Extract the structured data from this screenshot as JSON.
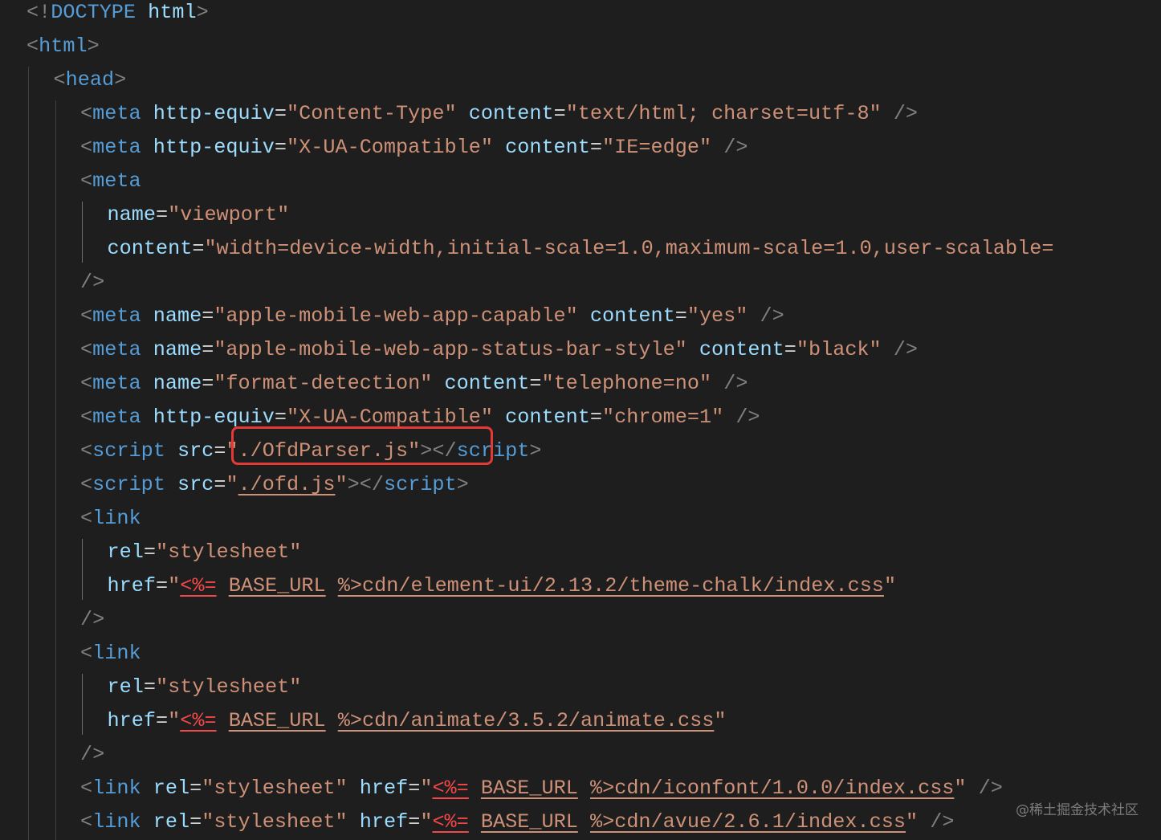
{
  "editor": {
    "lines": [
      {
        "indent": 0,
        "tokens": [
          [
            "punct",
            "<!"
          ],
          [
            "tag",
            "DOCTYPE"
          ],
          [
            "plain",
            " "
          ],
          [
            "attr",
            "html"
          ],
          [
            "punct",
            ">"
          ]
        ]
      },
      {
        "indent": 0,
        "tokens": [
          [
            "punct",
            "<"
          ],
          [
            "tag",
            "html"
          ],
          [
            "punct",
            ">"
          ]
        ]
      },
      {
        "indent": 1,
        "tokens": [
          [
            "punct",
            "<"
          ],
          [
            "tag",
            "head"
          ],
          [
            "punct",
            ">"
          ]
        ]
      },
      {
        "indent": 2,
        "tokens": [
          [
            "punct",
            "<"
          ],
          [
            "tag",
            "meta"
          ],
          [
            "plain",
            " "
          ],
          [
            "attr",
            "http-equiv"
          ],
          [
            "eq",
            "="
          ],
          [
            "str",
            "\"Content-Type\""
          ],
          [
            "plain",
            " "
          ],
          [
            "attr",
            "content"
          ],
          [
            "eq",
            "="
          ],
          [
            "str",
            "\"text/html; charset=utf-8\""
          ],
          [
            "plain",
            " "
          ],
          [
            "punct",
            "/>"
          ]
        ]
      },
      {
        "indent": 2,
        "tokens": [
          [
            "punct",
            "<"
          ],
          [
            "tag",
            "meta"
          ],
          [
            "plain",
            " "
          ],
          [
            "attr",
            "http-equiv"
          ],
          [
            "eq",
            "="
          ],
          [
            "str",
            "\"X-UA-Compatible\""
          ],
          [
            "plain",
            " "
          ],
          [
            "attr",
            "content"
          ],
          [
            "eq",
            "="
          ],
          [
            "str",
            "\"IE=edge\""
          ],
          [
            "plain",
            " "
          ],
          [
            "punct",
            "/>"
          ]
        ]
      },
      {
        "indent": 2,
        "tokens": [
          [
            "punct",
            "<"
          ],
          [
            "tag",
            "meta"
          ]
        ]
      },
      {
        "indent": 3,
        "tokens": [
          [
            "attr",
            "name"
          ],
          [
            "eq",
            "="
          ],
          [
            "str",
            "\"viewport\""
          ]
        ]
      },
      {
        "indent": 3,
        "tokens": [
          [
            "attr",
            "content"
          ],
          [
            "eq",
            "="
          ],
          [
            "str",
            "\"width=device-width,initial-scale=1.0,maximum-scale=1.0,user-scalable="
          ]
        ]
      },
      {
        "indent": 2,
        "tokens": [
          [
            "punct",
            "/>"
          ]
        ]
      },
      {
        "indent": 2,
        "tokens": [
          [
            "punct",
            "<"
          ],
          [
            "tag",
            "meta"
          ],
          [
            "plain",
            " "
          ],
          [
            "attr",
            "name"
          ],
          [
            "eq",
            "="
          ],
          [
            "str",
            "\"apple-mobile-web-app-capable\""
          ],
          [
            "plain",
            " "
          ],
          [
            "attr",
            "content"
          ],
          [
            "eq",
            "="
          ],
          [
            "str",
            "\"yes\""
          ],
          [
            "plain",
            " "
          ],
          [
            "punct",
            "/>"
          ]
        ]
      },
      {
        "indent": 2,
        "tokens": [
          [
            "punct",
            "<"
          ],
          [
            "tag",
            "meta"
          ],
          [
            "plain",
            " "
          ],
          [
            "attr",
            "name"
          ],
          [
            "eq",
            "="
          ],
          [
            "str",
            "\"apple-mobile-web-app-status-bar-style\""
          ],
          [
            "plain",
            " "
          ],
          [
            "attr",
            "content"
          ],
          [
            "eq",
            "="
          ],
          [
            "str",
            "\"black\""
          ],
          [
            "plain",
            " "
          ],
          [
            "punct",
            "/>"
          ]
        ]
      },
      {
        "indent": 2,
        "tokens": [
          [
            "punct",
            "<"
          ],
          [
            "tag",
            "meta"
          ],
          [
            "plain",
            " "
          ],
          [
            "attr",
            "name"
          ],
          [
            "eq",
            "="
          ],
          [
            "str",
            "\"format-detection\""
          ],
          [
            "plain",
            " "
          ],
          [
            "attr",
            "content"
          ],
          [
            "eq",
            "="
          ],
          [
            "str",
            "\"telephone=no\""
          ],
          [
            "plain",
            " "
          ],
          [
            "punct",
            "/>"
          ]
        ]
      },
      {
        "indent": 2,
        "tokens": [
          [
            "punct",
            "<"
          ],
          [
            "tag",
            "meta"
          ],
          [
            "plain",
            " "
          ],
          [
            "attr",
            "http-equiv"
          ],
          [
            "eq",
            "="
          ],
          [
            "str",
            "\"X-UA-Compatible\""
          ],
          [
            "plain",
            " "
          ],
          [
            "attr",
            "content"
          ],
          [
            "eq",
            "="
          ],
          [
            "str",
            "\"chrome=1\""
          ],
          [
            "plain",
            " "
          ],
          [
            "punct",
            "/>"
          ]
        ]
      },
      {
        "indent": 2,
        "tokens": [
          [
            "punct",
            "<"
          ],
          [
            "tag",
            "script"
          ],
          [
            "plain",
            " "
          ],
          [
            "attr",
            "src"
          ],
          [
            "eq",
            "="
          ],
          [
            "str",
            "\"./OfdParser.js\""
          ],
          [
            "punct",
            "></"
          ],
          [
            "tag",
            "script"
          ],
          [
            "punct",
            ">"
          ]
        ]
      },
      {
        "indent": 2,
        "tokens": [
          [
            "punct",
            "<"
          ],
          [
            "tag",
            "script"
          ],
          [
            "plain",
            " "
          ],
          [
            "attr",
            "src"
          ],
          [
            "eq",
            "="
          ],
          [
            "str",
            "\""
          ],
          [
            "link",
            "./ofd.js"
          ],
          [
            "str",
            "\""
          ],
          [
            "punct",
            "></"
          ],
          [
            "tag",
            "script"
          ],
          [
            "punct",
            ">"
          ]
        ]
      },
      {
        "indent": 2,
        "tokens": [
          [
            "punct",
            "<"
          ],
          [
            "tag",
            "link"
          ]
        ]
      },
      {
        "indent": 3,
        "tokens": [
          [
            "attr",
            "rel"
          ],
          [
            "eq",
            "="
          ],
          [
            "str",
            "\"stylesheet\""
          ]
        ]
      },
      {
        "indent": 3,
        "tokens": [
          [
            "attr",
            "href"
          ],
          [
            "eq",
            "="
          ],
          [
            "str",
            "\""
          ],
          [
            "tmpl",
            "<%="
          ],
          [
            "plain",
            " "
          ],
          [
            "link",
            "BASE_URL"
          ],
          [
            "plain",
            " "
          ],
          [
            "link",
            "%>cdn/element-ui/2.13.2/theme-chalk/index.css"
          ],
          [
            "str",
            "\""
          ]
        ]
      },
      {
        "indent": 2,
        "tokens": [
          [
            "punct",
            "/>"
          ]
        ]
      },
      {
        "indent": 2,
        "tokens": [
          [
            "punct",
            "<"
          ],
          [
            "tag",
            "link"
          ]
        ]
      },
      {
        "indent": 3,
        "tokens": [
          [
            "attr",
            "rel"
          ],
          [
            "eq",
            "="
          ],
          [
            "str",
            "\"stylesheet\""
          ]
        ]
      },
      {
        "indent": 3,
        "tokens": [
          [
            "attr",
            "href"
          ],
          [
            "eq",
            "="
          ],
          [
            "str",
            "\""
          ],
          [
            "tmpl",
            "<%="
          ],
          [
            "plain",
            " "
          ],
          [
            "link",
            "BASE_URL"
          ],
          [
            "plain",
            " "
          ],
          [
            "link",
            "%>cdn/animate/3.5.2/animate.css"
          ],
          [
            "str",
            "\""
          ]
        ]
      },
      {
        "indent": 2,
        "tokens": [
          [
            "punct",
            "/>"
          ]
        ]
      },
      {
        "indent": 2,
        "tokens": [
          [
            "punct",
            "<"
          ],
          [
            "tag",
            "link"
          ],
          [
            "plain",
            " "
          ],
          [
            "attr",
            "rel"
          ],
          [
            "eq",
            "="
          ],
          [
            "str",
            "\"stylesheet\""
          ],
          [
            "plain",
            " "
          ],
          [
            "attr",
            "href"
          ],
          [
            "eq",
            "="
          ],
          [
            "str",
            "\""
          ],
          [
            "tmpl",
            "<%="
          ],
          [
            "plain",
            " "
          ],
          [
            "link",
            "BASE_URL"
          ],
          [
            "plain",
            " "
          ],
          [
            "link",
            "%>cdn/iconfont/1.0.0/index.css"
          ],
          [
            "str",
            "\""
          ],
          [
            "plain",
            " "
          ],
          [
            "punct",
            "/>"
          ]
        ]
      },
      {
        "indent": 2,
        "tokens": [
          [
            "punct",
            "<"
          ],
          [
            "tag",
            "link"
          ],
          [
            "plain",
            " "
          ],
          [
            "attr",
            "rel"
          ],
          [
            "eq",
            "="
          ],
          [
            "str",
            "\"stylesheet\""
          ],
          [
            "plain",
            " "
          ],
          [
            "attr",
            "href"
          ],
          [
            "eq",
            "="
          ],
          [
            "str",
            "\""
          ],
          [
            "tmpl",
            "<%="
          ],
          [
            "plain",
            " "
          ],
          [
            "link",
            "BASE_URL"
          ],
          [
            "plain",
            " "
          ],
          [
            "link",
            "%>cdn/avue/2.6.1/index.css"
          ],
          [
            "str",
            "\""
          ],
          [
            "plain",
            " "
          ],
          [
            "punct",
            "/>"
          ]
        ]
      }
    ]
  },
  "watermark": "@稀土掘金技术社区",
  "colors": {
    "background": "#1e1e1e",
    "tag": "#569cd6",
    "attribute": "#9cdcfe",
    "string": "#ce9178",
    "punctuation": "#808080",
    "template_delimiter": "#f44747",
    "highlight_box": "#e53935"
  }
}
